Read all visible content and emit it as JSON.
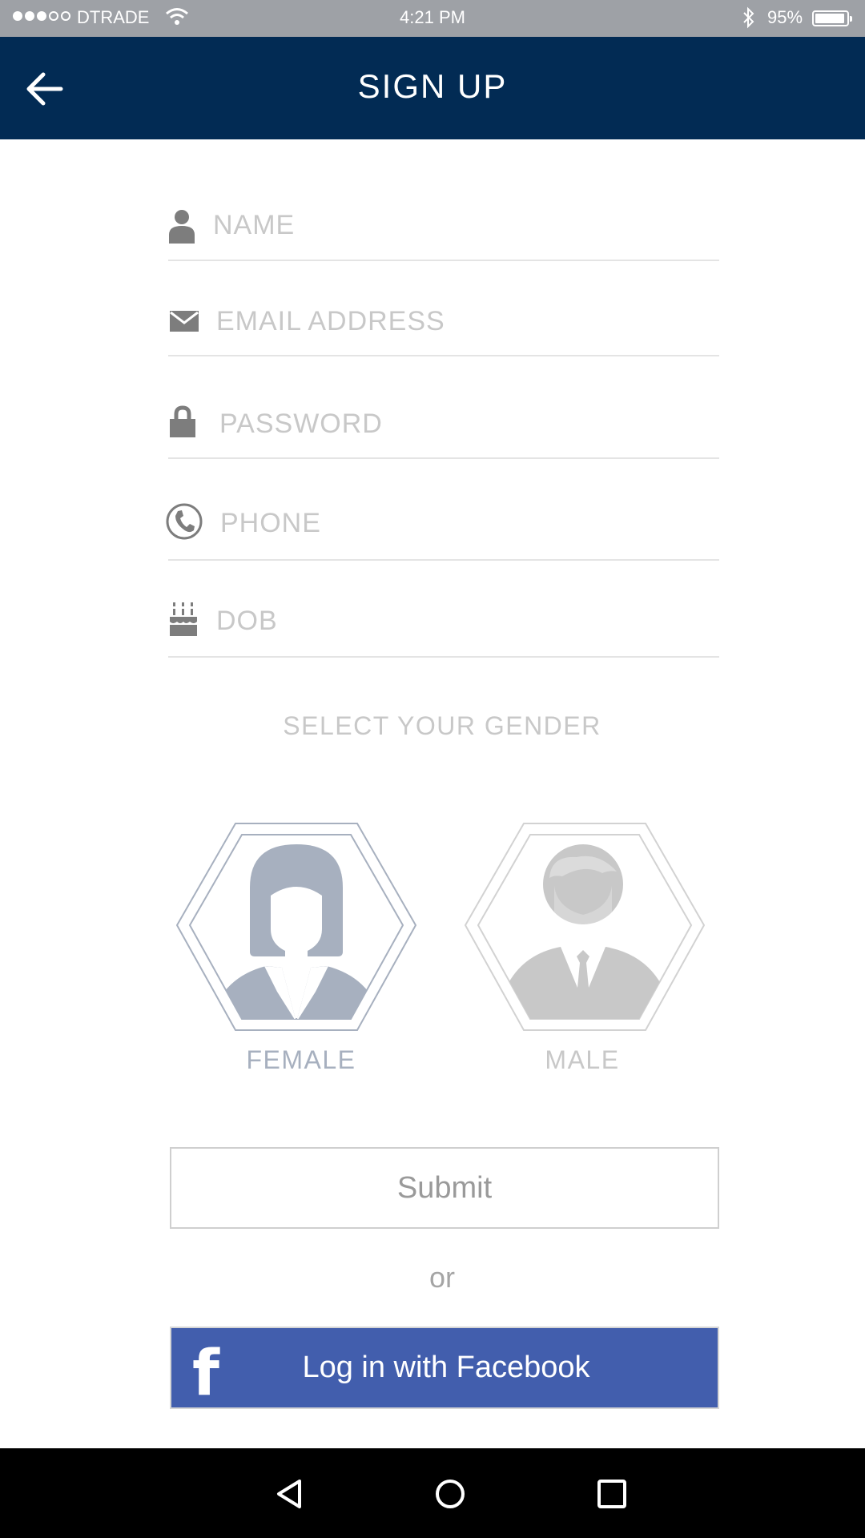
{
  "status_bar": {
    "signal_filled": 3,
    "signal_total": 5,
    "carrier": "DTRADE",
    "time": "4:21 PM",
    "battery_percent": "95%",
    "battery_level": 0.95
  },
  "header": {
    "title": "SIGN UP",
    "back_icon": "arrow-left-icon",
    "background": "#022b54"
  },
  "form": {
    "fields": [
      {
        "placeholder": "NAME",
        "icon": "person-icon"
      },
      {
        "placeholder": "EMAIL ADDRESS",
        "icon": "envelope-icon"
      },
      {
        "placeholder": "PASSWORD",
        "icon": "lock-icon"
      },
      {
        "placeholder": "PHONE",
        "icon": "phone-icon"
      },
      {
        "placeholder": "DOB",
        "icon": "cake-icon"
      }
    ],
    "gender_label": "SELECT YOUR GENDER",
    "genders": [
      {
        "label": "FEMALE",
        "icon": "female-avatar-icon",
        "selected": true,
        "color": "#a7b0bf"
      },
      {
        "label": "MALE",
        "icon": "male-avatar-icon",
        "selected": false,
        "color": "#c8c8c8"
      }
    ],
    "submit_label": "Submit",
    "or_label": "or",
    "facebook_label": "Log in with Facebook",
    "facebook_color": "#425ead"
  },
  "nav_bar": {
    "back_icon": "nav-back-icon",
    "home_icon": "nav-home-icon",
    "recents_icon": "nav-recents-icon"
  }
}
